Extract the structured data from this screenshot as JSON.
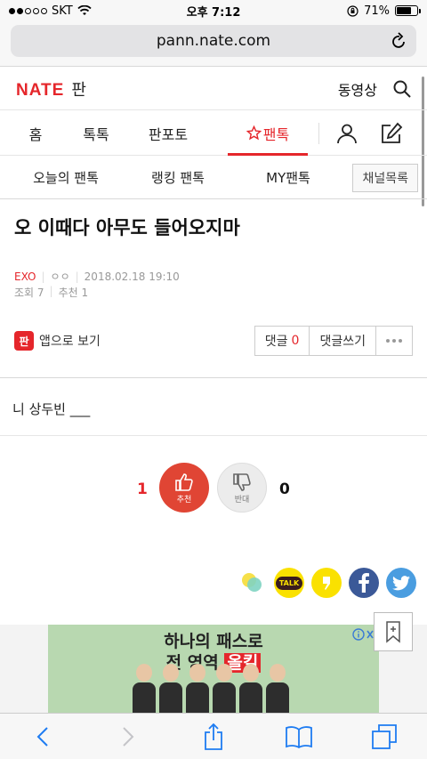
{
  "status_bar": {
    "carrier": "SKT",
    "time": "오후 7:12",
    "battery_percent": "71%",
    "battery_level": 0.71
  },
  "browser": {
    "url": "pann.nate.com"
  },
  "header": {
    "logo_brand": "NATE",
    "logo_section": "판",
    "video_label": "동영상"
  },
  "gnb": {
    "items": [
      "홈",
      "톡톡",
      "판포토",
      "팬톡"
    ],
    "active_index": 3
  },
  "subnav": {
    "items": [
      "오늘의 팬톡",
      "랭킹 팬톡",
      "MY팬톡"
    ],
    "channel_button": "채널목록"
  },
  "article": {
    "title": "오 이때다 아무도 들어오지마",
    "author": "EXO",
    "nickname": "ㅇㅇ",
    "datetime": "2018.02.18 19:10",
    "views": "조회 7",
    "recommend": "추천 1",
    "body": "니 상두빈 ___"
  },
  "actions": {
    "app_icon_text": "판",
    "app_view_label": "앱으로 보기",
    "comment_label": "댓글",
    "comment_count": "0",
    "write_comment_label": "댓글쓰기"
  },
  "vote": {
    "up_count": "1",
    "up_label": "추천",
    "down_count": "0",
    "down_label": "반대"
  },
  "share": {
    "kakaotalk_label": "TALK"
  },
  "ad": {
    "line1": "하나의 패스로",
    "line2_prefix": "전 영역",
    "line2_highlight": "올킬"
  },
  "colors": {
    "brand_red": "#e5262b",
    "vote_up": "#e04534",
    "facebook": "#3b5998",
    "twitter": "#4a9de0",
    "kakao_yellow": "#fae100"
  }
}
